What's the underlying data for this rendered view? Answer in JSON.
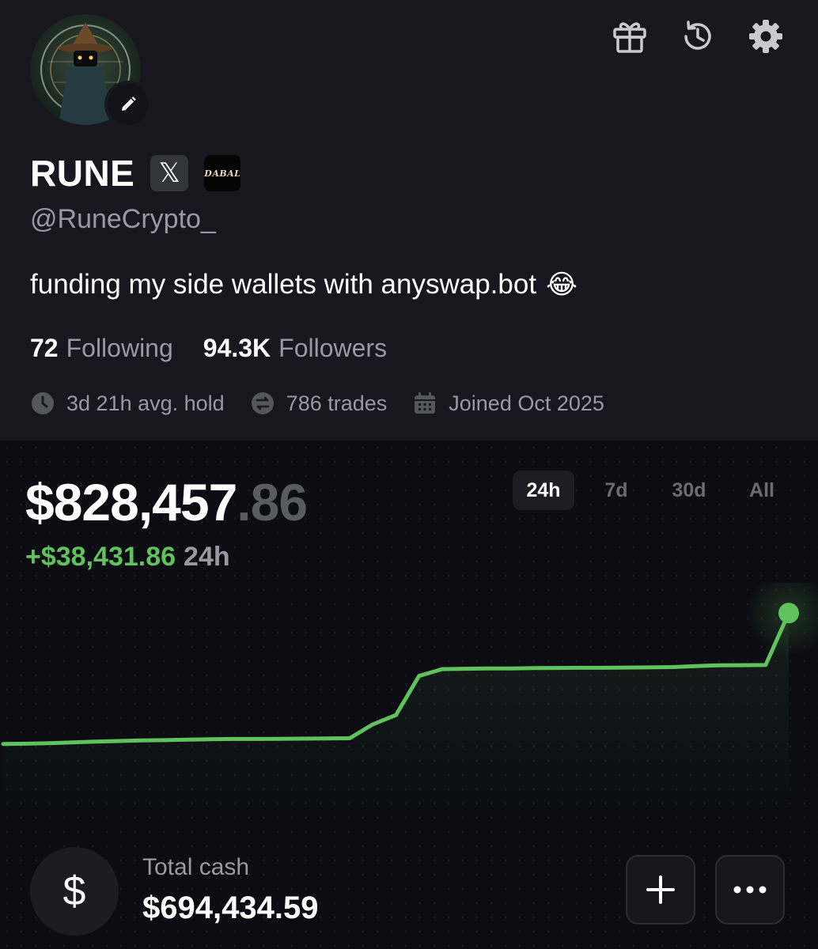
{
  "profile": {
    "name": "RUNE",
    "x_badge_glyph": "𝕏",
    "dabal_badge_text": "DABAL",
    "handle": "@RuneCrypto_",
    "bio": "funding my side wallets with anyswap.bot",
    "bio_emoji": "😂",
    "following_count": "72",
    "following_label": "Following",
    "followers_count": "94.3K",
    "followers_label": "Followers",
    "avg_hold": "3d 21h avg. hold",
    "trades": "786 trades",
    "joined": "Joined Oct 2025"
  },
  "header_icons": [
    "gift-icon",
    "history-icon",
    "gear-icon"
  ],
  "portfolio": {
    "balance_main": "$828,457",
    "balance_cents": ".86",
    "change_value": "+$38,431.86",
    "change_period": "24h",
    "periods": [
      {
        "label": "24h",
        "active": true
      },
      {
        "label": "7d",
        "active": false
      },
      {
        "label": "30d",
        "active": false
      },
      {
        "label": "All",
        "active": false
      }
    ]
  },
  "cash": {
    "currency_symbol": "$",
    "label": "Total cash",
    "value": "$694,434.59"
  },
  "actions": {
    "add_glyph": "+",
    "more_glyph": "•••"
  },
  "colors": {
    "accent_green": "#5fc25d",
    "background": "#0c0c12",
    "profile_background": "#18171f",
    "muted_text": "#9a99a3"
  },
  "chart_data": {
    "type": "line",
    "period": "24h",
    "series": [
      {
        "values": [
          790026,
          790100,
          790250,
          790500,
          790700,
          790900,
          791050,
          791150,
          791300,
          791400,
          791500,
          791500,
          791550,
          791600,
          791650,
          791700,
          795800,
          798500,
          810000,
          812000,
          812100,
          812200,
          812200,
          812300,
          812350,
          812400,
          812400,
          812450,
          812500,
          812600,
          812900,
          813100,
          813150,
          813200,
          828458
        ]
      }
    ],
    "ylim": [
      770000,
      835000
    ],
    "grid": false,
    "last_point_marker": true
  }
}
